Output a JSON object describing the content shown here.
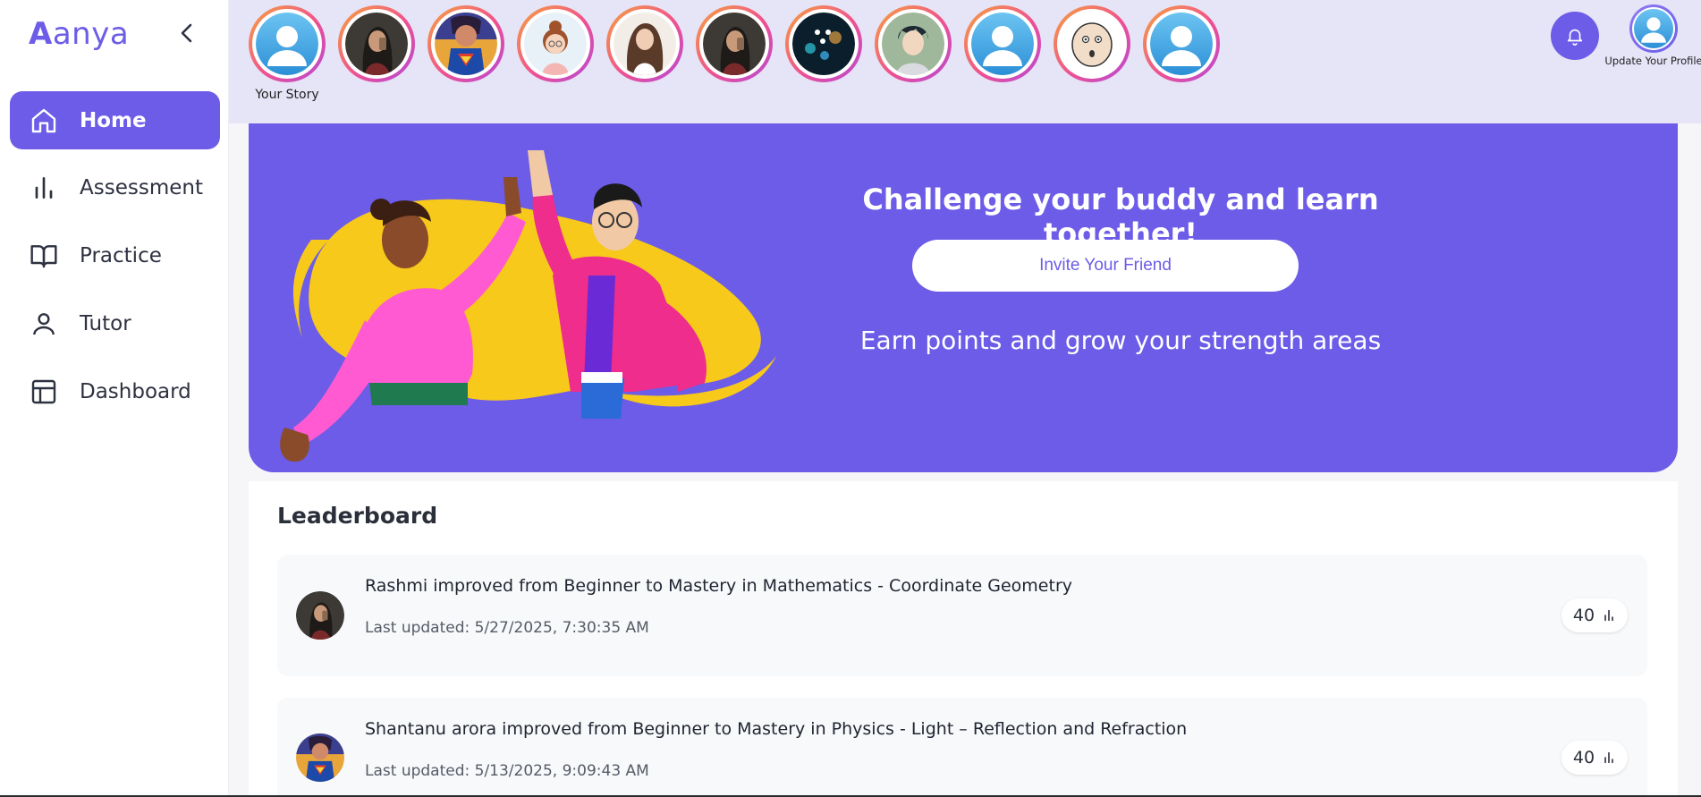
{
  "app": {
    "logo_first": "A",
    "logo_rest": "anya",
    "accent": "#6c5ce7"
  },
  "sidebar": {
    "items": [
      {
        "label": "Home",
        "icon": "home-icon",
        "active": true
      },
      {
        "label": "Assessment",
        "icon": "bar-chart-icon",
        "active": false
      },
      {
        "label": "Practice",
        "icon": "book-icon",
        "active": false
      },
      {
        "label": "Tutor",
        "icon": "user-icon",
        "active": false
      },
      {
        "label": "Dashboard",
        "icon": "layout-icon",
        "active": false
      }
    ]
  },
  "stories": {
    "your_story_label": "Your Story",
    "items": [
      {
        "icon": "default-avatar"
      },
      {
        "icon": "selfie-photo"
      },
      {
        "icon": "superhero-avatar"
      },
      {
        "icon": "cartoon-girl-avatar"
      },
      {
        "icon": "smiling-woman-photo"
      },
      {
        "icon": "selfie-photo"
      },
      {
        "icon": "city-lights-photo"
      },
      {
        "icon": "anime-boy-avatar"
      },
      {
        "icon": "default-avatar"
      },
      {
        "icon": "cartoon-face-avatar"
      },
      {
        "icon": "default-avatar"
      }
    ]
  },
  "header": {
    "profile_label": "Update Your Profile"
  },
  "banner": {
    "title": "Challenge your buddy and learn together!",
    "button_label": "Invite Your Friend",
    "subtitle": "Earn points and grow your strength areas"
  },
  "leaderboard": {
    "title": "Leaderboard",
    "entries": [
      {
        "text": "Rashmi improved from Beginner to Mastery in Mathematics - Coordinate Geometry",
        "time": "Last updated: 5/27/2025, 7:30:35 AM",
        "score": "40"
      },
      {
        "text": "Shantanu arora improved from Beginner to Mastery in Physics - Light – Reflection and Refraction",
        "time": "Last updated: 5/13/2025, 9:09:43 AM",
        "score": "40"
      }
    ]
  }
}
